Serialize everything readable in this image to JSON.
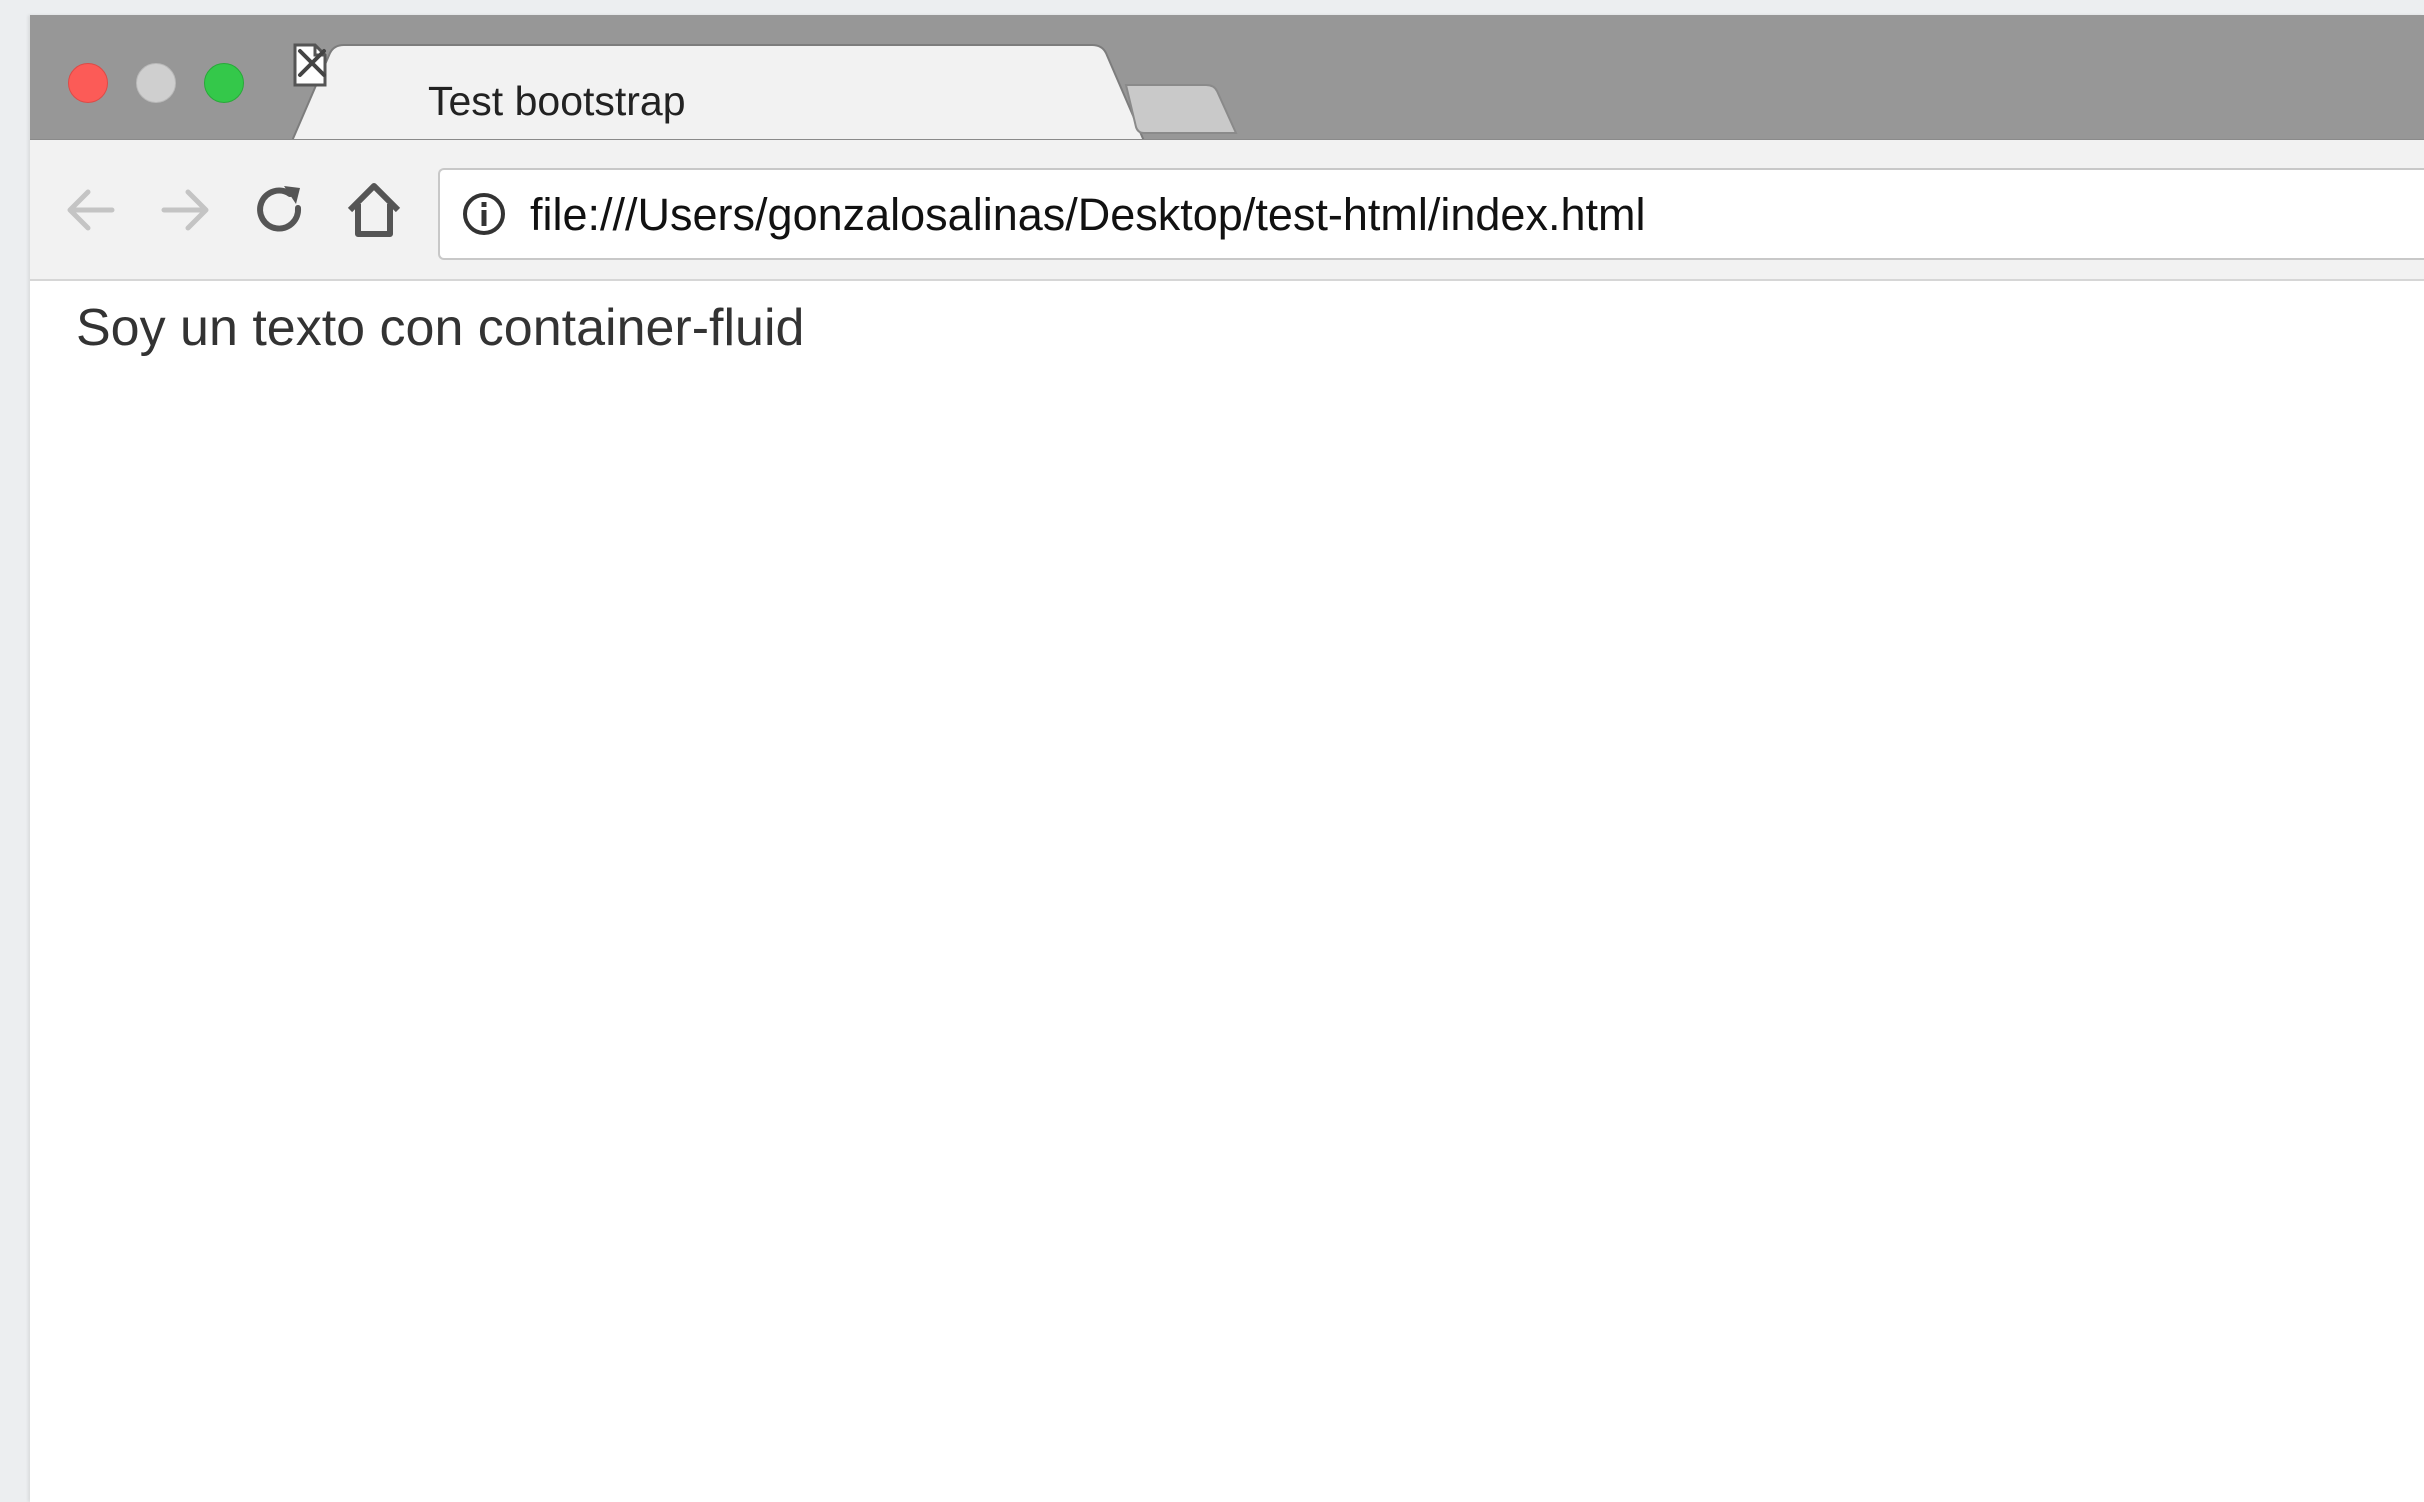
{
  "browser": {
    "tab": {
      "title": "Test bootstrap",
      "icon": "page-icon"
    },
    "address_bar": {
      "url": "file:///Users/gonzalosalinas/Desktop/test-html/index.html",
      "security_icon": "info-icon"
    },
    "toolbar_icons": [
      "back-arrow-icon",
      "forward-arrow-icon",
      "reload-icon",
      "home-icon"
    ]
  },
  "page": {
    "text": "Soy un texto con container-fluid"
  },
  "colors": {
    "close": "#fc5b57",
    "minimize": "#cfcfcf",
    "maximize": "#34c84a",
    "tab_strip": "#979797",
    "toolbar": "#f2f2f2"
  }
}
